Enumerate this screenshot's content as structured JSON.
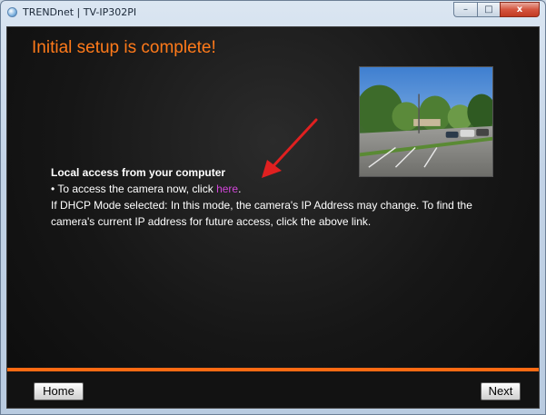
{
  "window": {
    "title": "TRENDnet | TV-IP302PI",
    "minimize": "–",
    "maximize": "□",
    "close": "x"
  },
  "main": {
    "heading": "Initial setup is complete!",
    "section_title": "Local access from your computer",
    "bullet_prefix": "• To access the camera now, click ",
    "link_text": "here",
    "bullet_suffix": ".",
    "note_line1": "If DHCP Mode selected: In this mode, the camera's IP Address may change. To find the",
    "note_line2": "camera's current IP address for future access, click the above link."
  },
  "footer": {
    "home_label": "Home",
    "next_label": "Next"
  },
  "colors": {
    "heading": "#ff7a1a",
    "link": "#d146d8",
    "accent_bar": "#ff6a13",
    "arrow": "#e02020"
  },
  "icons": {
    "arrow": "red-arrow-icon",
    "app": "camera-app-icon",
    "photo": "camera-view-photo"
  }
}
